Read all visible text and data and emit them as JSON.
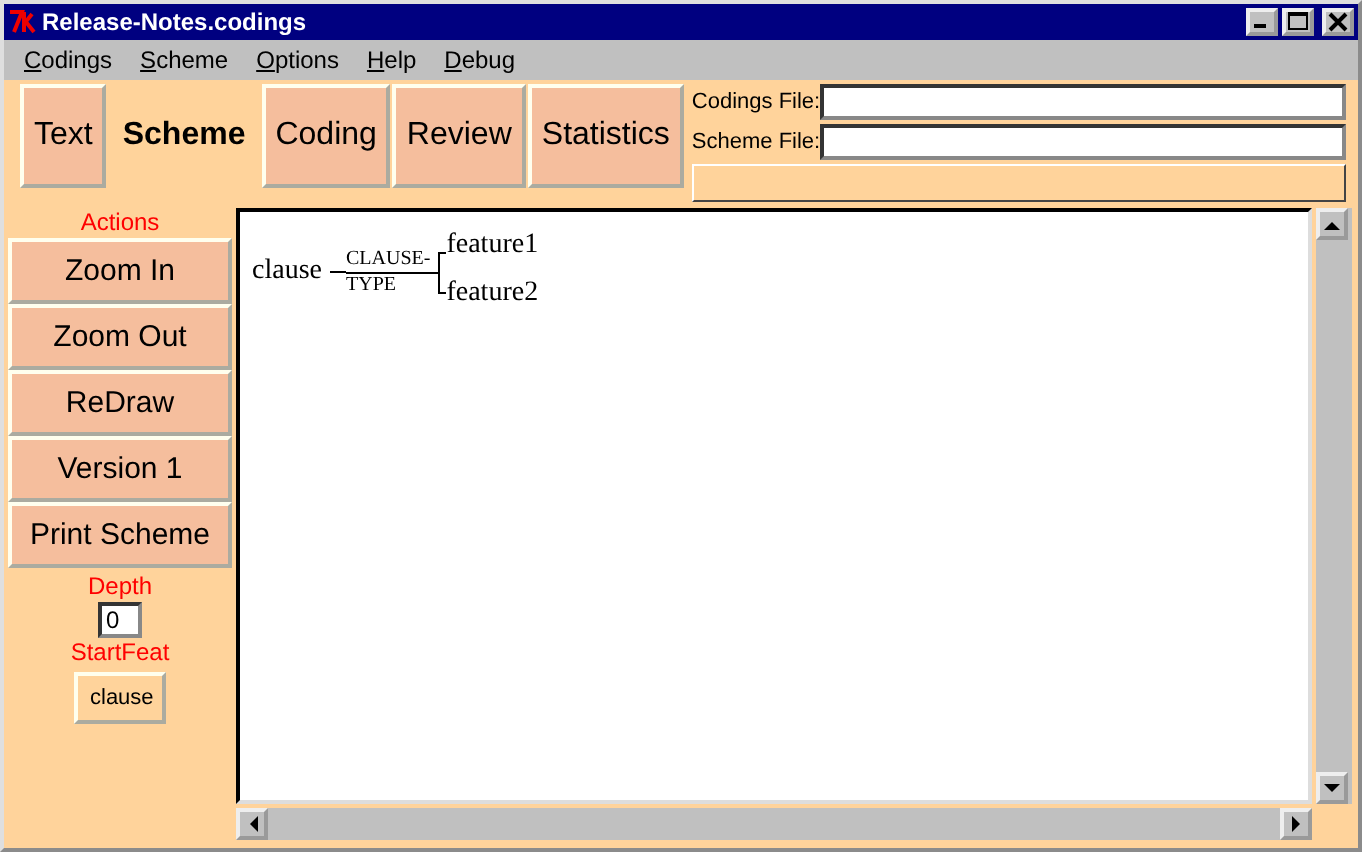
{
  "window": {
    "title": "Release-Notes.codings"
  },
  "menu": [
    "Codings",
    "Scheme",
    "Options",
    "Help",
    "Debug"
  ],
  "tabs": [
    {
      "label": "Text",
      "selected": false
    },
    {
      "label": "Scheme",
      "selected": true
    },
    {
      "label": "Coding",
      "selected": false
    },
    {
      "label": "Review",
      "selected": false
    },
    {
      "label": "Statistics",
      "selected": false
    }
  ],
  "files": [
    {
      "label": "Codings File:"
    },
    {
      "label": "Scheme File:"
    }
  ],
  "actions": {
    "title": "Actions",
    "buttons": [
      "Zoom In",
      "Zoom Out",
      "ReDraw",
      "Version 1",
      "Print Scheme"
    ]
  },
  "depth": {
    "label": "Depth",
    "value": "0"
  },
  "start_feat": {
    "label": "StartFeat",
    "button": "clause"
  },
  "scheme": {
    "root": "clause",
    "system": [
      "CLAUSE-",
      "TYPE"
    ],
    "features": [
      "feature1",
      "feature2"
    ]
  }
}
